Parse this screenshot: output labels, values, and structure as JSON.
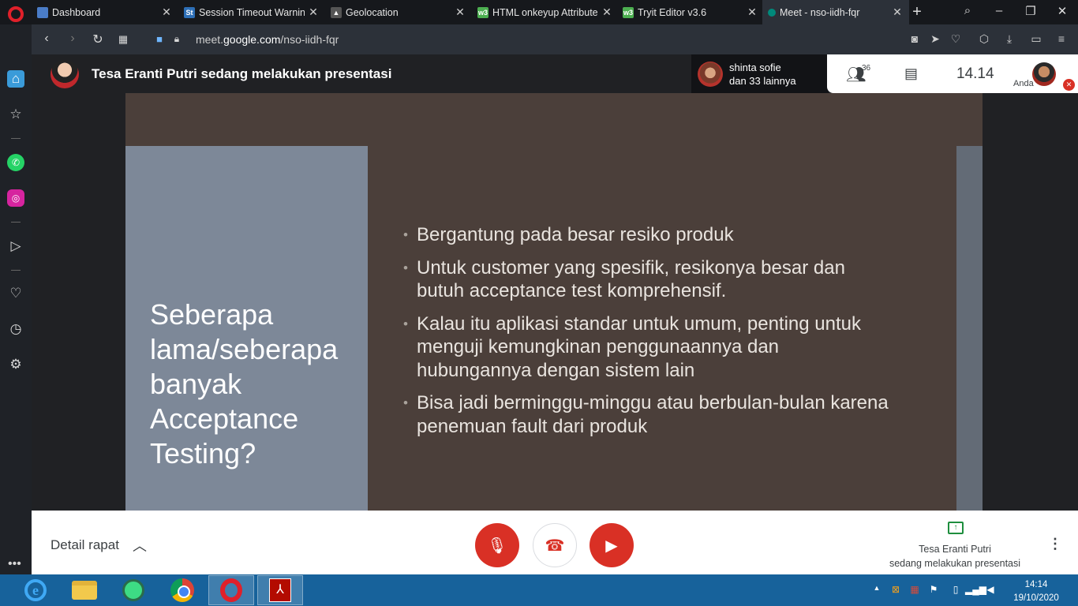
{
  "browser": {
    "tabs": [
      {
        "label": "Dashboard",
        "icon": "dashboard-favicon",
        "color": "#4a7cc7"
      },
      {
        "label": "Session Timeout Warning",
        "icon": "st-favicon",
        "color": "#2d6fb7"
      },
      {
        "label": "Geolocation",
        "icon": "geolocation-favicon",
        "color": "#555555"
      },
      {
        "label": "HTML onkeyup Attribute",
        "icon": "w3-favicon",
        "color": "#4caf50"
      },
      {
        "label": "Tryit Editor v3.6",
        "icon": "w3-favicon",
        "color": "#4caf50"
      },
      {
        "label": "Meet - nso-iidh-fqr",
        "icon": "meet-favicon",
        "color": "#00897b"
      }
    ],
    "url_prefix": "meet.",
    "url_domain": "google.com",
    "url_path": "/nso-iidh-fqr"
  },
  "meet": {
    "presenter_title": "Tesa Eranti Putri sedang melakukan presentasi",
    "speaker_name": "shinta sofie",
    "speaker_others": "dan 33 lainnya",
    "participant_count": "36",
    "clock": "14.14",
    "self_label": "Anda",
    "details_label": "Detail rapat",
    "present_line1": "Tesa Eranti Putri",
    "present_line2": "sedang melakukan presentasi"
  },
  "slide": {
    "heading": "Seberapa lama/seberapa banyak Acceptance Testing?",
    "bullets": [
      "Bergantung pada besar resiko produk",
      "Untuk customer yang spesifik, resikonya besar dan butuh acceptance test komprehensif.",
      "Kalau itu aplikasi standar untuk umum, penting untuk menguji kemungkinan penggunaannya dan hubungannya dengan sistem lain",
      "Bisa jadi berminggu-minggu atau berbulan-bulan karena penemuan fault dari produk"
    ]
  },
  "taskbar": {
    "time": "14:14",
    "date": "19/10/2020"
  },
  "colors": {
    "slide_bg": "#4b3f3a",
    "slide_left": "#7d8898",
    "meet_red": "#d93025",
    "taskbar": "#17629b"
  }
}
